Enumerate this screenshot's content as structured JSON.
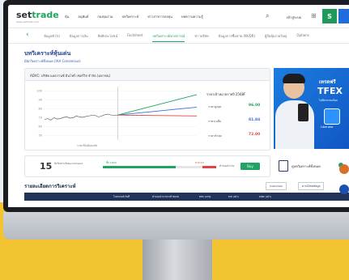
{
  "header": {
    "logo_main": "set",
    "logo_accent": "trade",
    "logo_sub": "www.settrade.com",
    "nav": [
      "หุ้น",
      "อนุพันธ์",
      "กองทุนรวม",
      "บทวิเคราะห์",
      "ข่าวสารการลงทุน",
      "บทความความรู้"
    ],
    "login": "เข้าสู่ระบบ",
    "s_badge": "S"
  },
  "subnav": {
    "items": [
      "ข้อมูลทั่วไป",
      "ข้อมูลการเงิน",
      "สิทธิประโยชน์",
      "Factsheet",
      "บทวิเคราะห์/คาดการณ์",
      "ข่าวบริษัท",
      "ข้อมูลการซื้อขาย (NVDR)",
      "ผู้ถือหุ้นรายใหญ่",
      "Options"
    ],
    "active_index": 4
  },
  "page": {
    "title": "บทวิเคราะห์หุ้นเด่น",
    "subtitle": "มีนักวิเคราะห์ทั้งหมด (IAA Consensus)"
  },
  "chart_card": {
    "heading": "ADVC: บริษัท แอดวานซ์ อินโฟร์ เซอร์วิส จำกัด (มหาชน)",
    "target_title": "ราคาเป้าหมายรายปี 2568F",
    "targets": [
      {
        "label": "ราคาสูงสุด",
        "value": "96.00",
        "color": "#1fa463"
      },
      {
        "label": "ราคาเฉลี่ย",
        "value": "81.84",
        "color": "#3b6ee0"
      },
      {
        "label": "ราคาต่ำสุด",
        "value": "72.00",
        "color": "#e04545"
      }
    ],
    "x_label": "ราคาปิดย้อนหลัง"
  },
  "chart_data": {
    "type": "line",
    "title": "",
    "xlabel": "",
    "ylabel": "",
    "y_ticks": [
      "100",
      "90",
      "80",
      "70",
      "60",
      "50"
    ],
    "ylim": [
      45,
      105
    ],
    "history": [
      68,
      69,
      67.5,
      70,
      68.5,
      69,
      70.5,
      71,
      69.5,
      70,
      72,
      71,
      70.5,
      71.5,
      72,
      73,
      72.5,
      71,
      72,
      73.5,
      74,
      73,
      72.5,
      73
    ],
    "projections": [
      {
        "name": "ราคาสูงสุด",
        "from": 73,
        "to": 96,
        "color": "#1fa463"
      },
      {
        "name": "ราคาเฉลี่ย",
        "from": 73,
        "to": 81.84,
        "color": "#3b6ee0"
      },
      {
        "name": "ราคาต่ำสุด",
        "from": 73,
        "to": 72,
        "color": "#e04545"
      }
    ],
    "grid": true
  },
  "ad": {
    "line1": "เทรดฟรี",
    "line2": "TFEX",
    "line3": "ไม่มีค่าธรรมเนียม",
    "app": "Liberator"
  },
  "analysts": {
    "count": "15",
    "count_label": "นักวิเคราะห์ Recommend",
    "buy_label": "ซื้อ 100%",
    "sell_label": "ขาย 0%",
    "consensus_label": "คำแนะนำรวม",
    "consensus": "Buy",
    "buy_fraction": 0.64,
    "sell_fraction": 0.12
  },
  "reco_box": {
    "text": "ดูบทวิเคราะห์ทั้งหมด"
  },
  "table": {
    "title": "รายละเอียดการวิเคราะห์",
    "buttons": [
      "Customize",
      "ดาวน์โหลดข้อมูล"
    ],
    "columns": [
      "โบรกเกอร์/วันที่",
      "คำแนะนำ/ราคาเป้าหมาย",
      "EPS (บาท)",
      "P/E (เท่า)",
      "P/BV (เท่า)"
    ]
  }
}
